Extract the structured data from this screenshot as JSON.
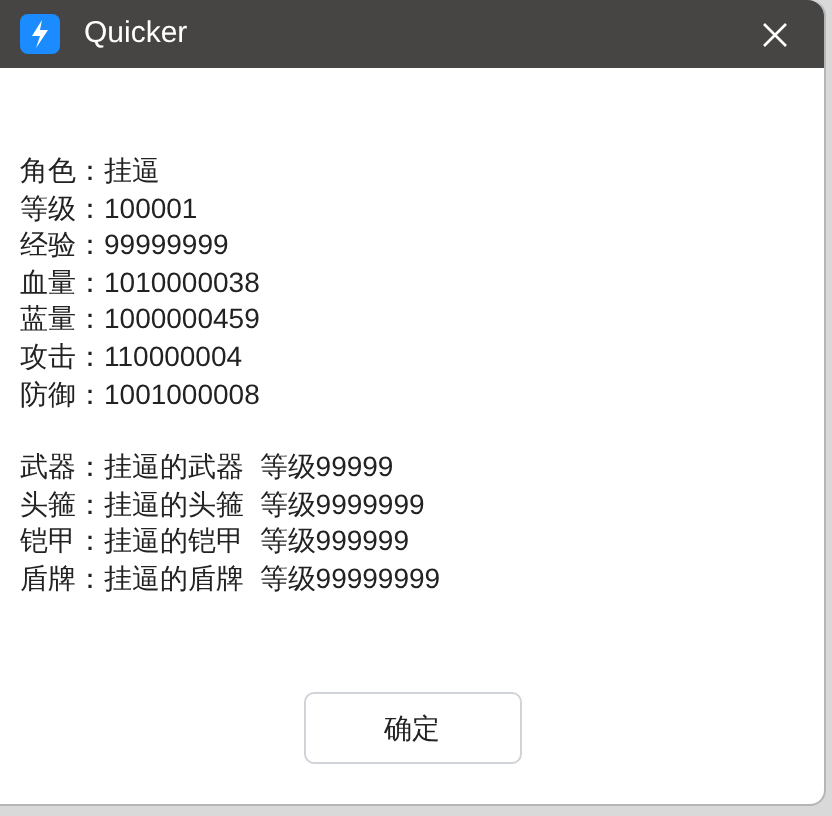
{
  "window": {
    "title": "Quicker"
  },
  "groups": [
    {
      "lines": [
        "角色：挂逼",
        "等级：100001",
        "经验：99999999",
        "血量：1010000038",
        "蓝量：1000000459",
        "攻击：110000004",
        "防御：1001000008"
      ]
    },
    {
      "lines": [
        "武器：挂逼的武器  等级99999",
        "头箍：挂逼的头箍  等级9999999",
        "铠甲：挂逼的铠甲  等级999999",
        "盾牌：挂逼的盾牌  等级99999999"
      ]
    }
  ],
  "buttons": [
    "确定"
  ]
}
